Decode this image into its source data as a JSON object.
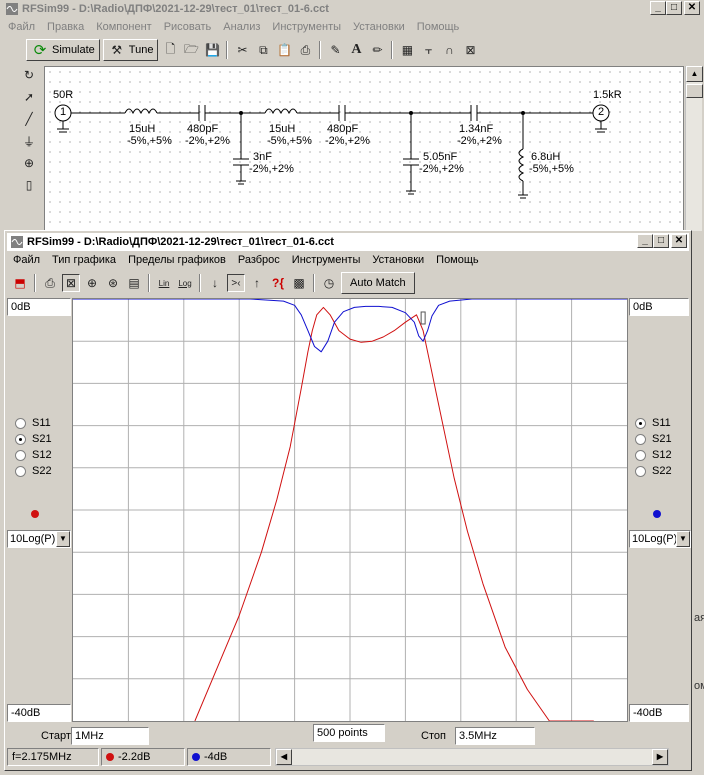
{
  "main_window": {
    "title": "RFSim99 - D:\\Radio\\ДПФ\\2021-12-29\\тест_01\\тест_01-6.cct",
    "menu": [
      "Файл",
      "Правка",
      "Компонент",
      "Рисовать",
      "Анализ",
      "Инструменты",
      "Установки",
      "Помощь"
    ],
    "simulate_label": "Simulate",
    "tune_label": "Tune",
    "toolbar_text_icon": "A"
  },
  "schematic": {
    "port1": {
      "label": "50R",
      "number": "1"
    },
    "port2": {
      "label": "1.5kR",
      "number": "2"
    },
    "components": [
      {
        "name": "ind1",
        "value": "15uH",
        "tol": "-5%,+5%"
      },
      {
        "name": "cap1",
        "value": "480pF",
        "tol": "-2%,+2%"
      },
      {
        "name": "cap_sh1",
        "value": "3nF",
        "tol": "-2%,+2%"
      },
      {
        "name": "ind2",
        "value": "15uH",
        "tol": "-5%,+5%"
      },
      {
        "name": "cap2",
        "value": "480pF",
        "tol": "-2%,+2%"
      },
      {
        "name": "cap_sh2",
        "value": "5.05nF",
        "tol": "-2%,+2%"
      },
      {
        "name": "cap3",
        "value": "1.34nF",
        "tol": "-2%,+2%"
      },
      {
        "name": "ind_sh",
        "value": "6.8uH",
        "tol": "-5%,+5%"
      }
    ]
  },
  "graph_window": {
    "title": "RFSim99 - D:\\Radio\\ДПФ\\2021-12-29\\тест_01\\тест_01-6.cct",
    "menu": [
      "Файл",
      "Тип графика",
      "Пределы графиков",
      "Разброс",
      "Инструменты",
      "Установки",
      "Помощь"
    ],
    "lin_label": "Lin",
    "log_label": "Log",
    "auto_match_label": "Auto Match",
    "left_top": "0dB",
    "left_bottom": "-40dB",
    "right_top": "0dB",
    "right_bottom": "-40dB",
    "left_params": [
      "S11",
      "S21",
      "S12",
      "S22"
    ],
    "left_selected": "S21",
    "right_params": [
      "S11",
      "S21",
      "S12",
      "S22"
    ],
    "right_selected": "S11",
    "left_scale": "10Log(P)",
    "right_scale": "10Log(P)",
    "left_color": "#d01010",
    "right_color": "#1010d0",
    "start_label": "Старт",
    "start_value": "1MHz",
    "points_value": "500 points",
    "stop_label": "Стоп",
    "stop_value": "3.5MHz",
    "status_freq": "f=2.175MHz",
    "status_red": "-2.2dB",
    "status_blue": "-4dB",
    "right_edge_text_1": "ая",
    "right_edge_text_2": "ом"
  },
  "chart_data": {
    "type": "line",
    "x_range_mhz": [
      1,
      3.5
    ],
    "ylim": [
      -40,
      0
    ],
    "grid": true,
    "series": [
      {
        "color": "#d01010",
        "x": [
          1.55,
          1.65,
          1.75,
          1.85,
          1.92,
          1.98,
          2.03,
          2.06,
          2.08,
          2.1,
          2.13,
          2.16,
          2.2,
          2.25,
          2.3,
          2.35,
          2.4,
          2.45,
          2.5,
          2.55,
          2.58,
          2.61,
          2.64,
          2.68,
          2.72,
          2.78,
          2.85,
          2.95,
          3.05,
          3.15,
          3.25,
          3.35
        ],
        "y": [
          -40,
          -35,
          -30,
          -24,
          -19,
          -14,
          -8.5,
          -5,
          -3,
          -1.5,
          -0.8,
          -1.5,
          -3,
          -3.8,
          -4.1,
          -4,
          -3.6,
          -3,
          -2.2,
          -1.5,
          -3,
          -6,
          -9,
          -13,
          -17,
          -22,
          -27,
          -33,
          -37,
          -40,
          -40,
          -40
        ]
      },
      {
        "color": "#1010d0",
        "x": [
          1.0,
          1.5,
          1.8,
          1.95,
          2.0,
          2.03,
          2.06,
          2.09,
          2.12,
          2.15,
          2.18,
          2.22,
          2.27,
          2.32,
          2.38,
          2.44,
          2.5,
          2.54,
          2.56,
          2.58,
          2.6,
          2.62,
          2.65,
          2.7,
          2.8,
          3.0,
          3.5
        ],
        "y": [
          0,
          0,
          0,
          -0.2,
          -0.6,
          -1.5,
          -3,
          -4.5,
          -5,
          -4,
          -2.2,
          -1.2,
          -0.8,
          -0.7,
          -0.7,
          -0.8,
          -1.3,
          -2.2,
          -3.5,
          -4,
          -3,
          -1.6,
          -0.6,
          -0.2,
          0,
          0,
          0
        ]
      }
    ]
  }
}
